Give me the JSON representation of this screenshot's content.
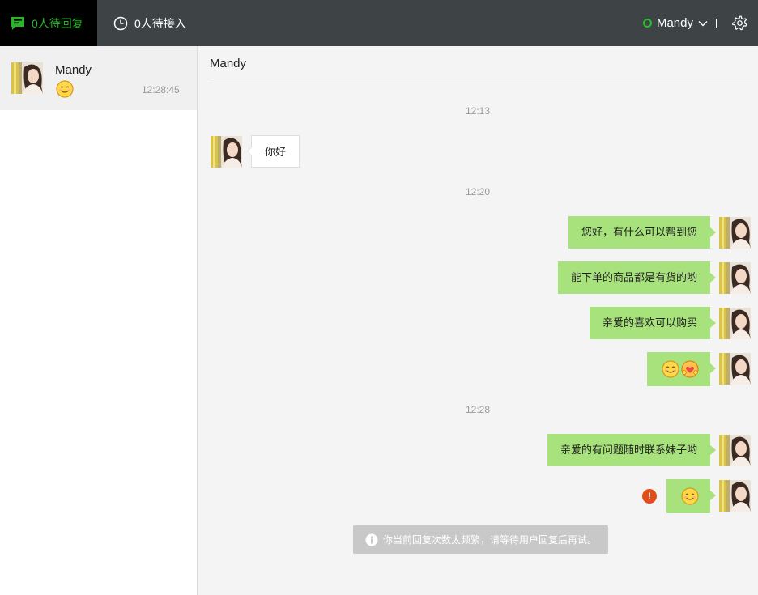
{
  "topbar": {
    "tab_pending_reply": "0人待回复",
    "tab_pending_access": "0人待接入",
    "account_name": "Mandy",
    "accent_color": "#27b627"
  },
  "sidebar": {
    "conversations": [
      {
        "name": "Mandy",
        "last_message": "smile-emoji",
        "time": "12:28:45"
      }
    ]
  },
  "chat": {
    "title": "Mandy",
    "timestamps": [
      "12:13",
      "12:20",
      "12:28"
    ],
    "messages": [
      {
        "direction": "in",
        "text": "你好"
      },
      {
        "direction": "out",
        "text": "您好，有什么可以帮到您"
      },
      {
        "direction": "out",
        "text": "能下单的商品都是有货的哟"
      },
      {
        "direction": "out",
        "text": "亲爱的喜欢可以购买"
      },
      {
        "direction": "out",
        "emoji": [
          "smile-emoji",
          "heart-hug-emoji"
        ]
      },
      {
        "direction": "out",
        "text": "亲爱的有问题随时联系妹子哟"
      },
      {
        "direction": "out",
        "emoji": [
          "smile-emoji"
        ],
        "status": "failed"
      }
    ],
    "error_glyph": "!",
    "notice": "你当前回复次数太频繁，请等待用户回复后再试。"
  }
}
